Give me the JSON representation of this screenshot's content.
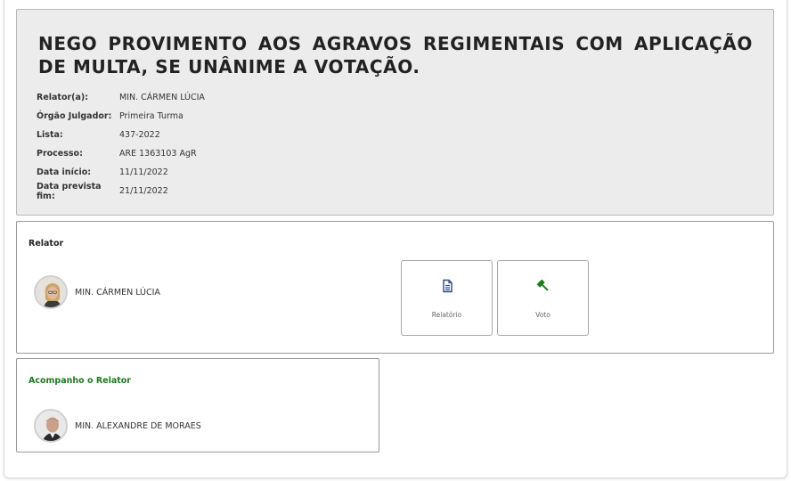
{
  "decision": {
    "title": "NEGO PROVIMENTO AOS AGRAVOS REGIMENTAIS COM APLICAÇÃO DE MULTA, SE UNÂNIME A VOTAÇÃO."
  },
  "meta": [
    {
      "label": "Relator(a):",
      "value": "MIN. CÁRMEN LÚCIA"
    },
    {
      "label": "Órgão Julgador:",
      "value": "Primeira Turma"
    },
    {
      "label": "Lista:",
      "value": "437-2022"
    },
    {
      "label": "Processo:",
      "value": "ARE 1363103 AgR"
    },
    {
      "label": "Data início:",
      "value": "11/11/2022"
    },
    {
      "label": "Data prevista fim:",
      "value": "21/11/2022"
    }
  ],
  "relator": {
    "title": "Relator",
    "name": "MIN. CÁRMEN LÚCIA",
    "buttons": [
      {
        "label": "Relatório",
        "icon": "document-icon"
      },
      {
        "label": "Voto",
        "icon": "gavel-icon"
      }
    ]
  },
  "acompanho": {
    "title": "Acompanho o Relator",
    "name": "MIN. ALEXANDRE DE MORAES"
  },
  "colors": {
    "accent_green": "#1f7a1f",
    "header_bg": "#ececec",
    "document_icon": "#2e4a78"
  }
}
